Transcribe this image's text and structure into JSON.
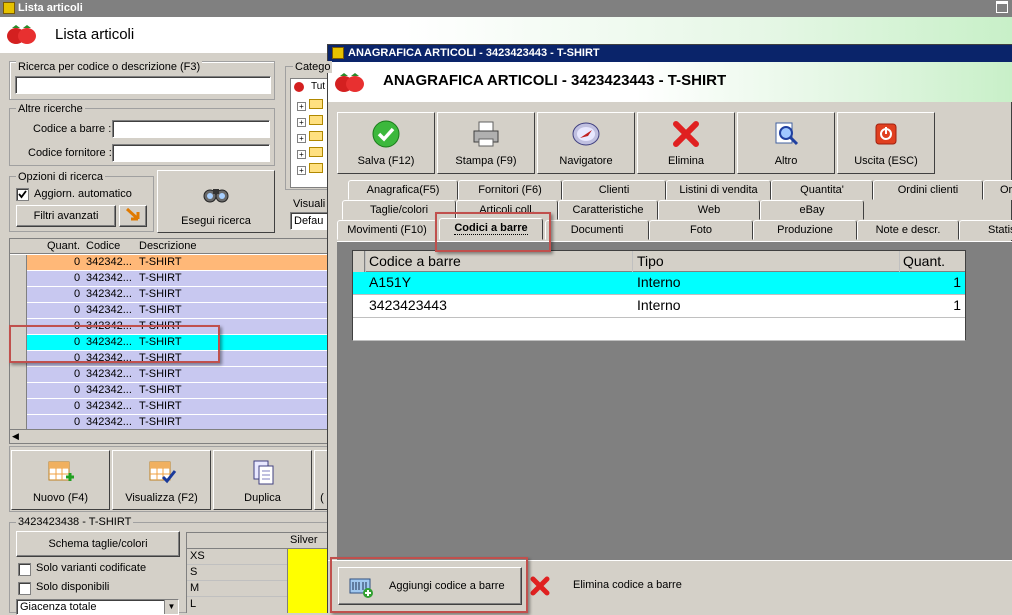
{
  "main_window": {
    "title": "Lista articoli",
    "header_title": "Lista articoli"
  },
  "search": {
    "by_code_label": "Ricerca per codice o descrizione (F3)",
    "by_code_value": "",
    "other_searches_label": "Altre ricerche",
    "barcode_label": "Codice a barre :",
    "supplier_code_label": "Codice fornitore :",
    "options_label": "Opzioni di ricerca",
    "auto_update_label": "Aggiorn. automatico",
    "auto_update_checked": true,
    "advanced_filters_label": "Filtri avanzati",
    "execute_label": "Esegui ricerca",
    "categories_label": "Catego",
    "categories_root": "Tut",
    "view_label": "Visuali",
    "view_value": "Defau"
  },
  "article_grid": {
    "headers": [
      "Quant.",
      "Codice",
      "Descrizione"
    ],
    "rows": [
      {
        "qty": "0",
        "code": "342342...",
        "desc": "T-SHIRT",
        "color": "#ffb878"
      },
      {
        "qty": "0",
        "code": "342342...",
        "desc": "T-SHIRT",
        "color": "#c8c8f0"
      },
      {
        "qty": "0",
        "code": "342342...",
        "desc": "T-SHIRT",
        "color": "#c8c8f0"
      },
      {
        "qty": "0",
        "code": "342342...",
        "desc": "T-SHIRT",
        "color": "#c8c8f0"
      },
      {
        "qty": "0",
        "code": "342342...",
        "desc": "T-SHIRT",
        "color": "#c8c8f0"
      },
      {
        "qty": "0",
        "code": "342342...",
        "desc": "T-SHIRT",
        "color": "#00ffff"
      },
      {
        "qty": "0",
        "code": "342342...",
        "desc": "T-SHIRT",
        "color": "#c8c8f0"
      },
      {
        "qty": "0",
        "code": "342342...",
        "desc": "T-SHIRT",
        "color": "#c8c8f0"
      },
      {
        "qty": "0",
        "code": "342342...",
        "desc": "T-SHIRT",
        "color": "#c8c8f0"
      },
      {
        "qty": "0",
        "code": "342342...",
        "desc": "T-SHIRT",
        "color": "#c8c8f0"
      },
      {
        "qty": "0",
        "code": "342342...",
        "desc": "T-SHIRT",
        "color": "#c8c8f0"
      }
    ]
  },
  "left_actions": {
    "new_label": "Nuovo (F4)",
    "view_label": "Visualizza (F2)",
    "duplicate_label": "Duplica",
    "more_label": "("
  },
  "variants": {
    "group_label": "3423423438 - T-SHIRT",
    "scheme_button": "Schema taglie/colori",
    "only_coded_label": "Solo varianti codificate",
    "only_available_label": "Solo disponibili",
    "stock_select_value": "Giacenza totale",
    "color_header": "Silver",
    "sizes": [
      "XS",
      "S",
      "M",
      "L"
    ]
  },
  "dialog": {
    "title": "ANAGRAFICA ARTICOLI - 3423423443 - T-SHIRT",
    "header_title": "ANAGRAFICA ARTICOLI - 3423423443 - T-SHIRT",
    "toolbar": {
      "save": "Salva (F12)",
      "print": "Stampa (F9)",
      "navigator": "Navigatore",
      "delete": "Elimina",
      "other": "Altro",
      "exit": "Uscita (ESC)"
    },
    "tabs_row1": [
      "Anagrafica(F5)",
      "Fornitori (F6)",
      "Clienti",
      "Listini di vendita",
      "Quantita'",
      "Ordini clienti",
      "Or"
    ],
    "tabs_row2": [
      "Taglie/colori",
      "Articoli coll.",
      "Caratteristiche",
      "Web",
      "eBay"
    ],
    "tabs_row3": [
      "Movimenti (F10)",
      "Codici a barre",
      "Documenti",
      "Foto",
      "Produzione",
      "Note e descr.",
      "Statis"
    ],
    "barcode_grid": {
      "headers": [
        "Codice a barre",
        "Tipo",
        "Quant."
      ],
      "rows": [
        {
          "code": "A151Y",
          "type": "Interno",
          "qty": "1"
        },
        {
          "code": "3423423443",
          "type": "Interno",
          "qty": "1"
        }
      ]
    },
    "add_barcode_label": "Aggiungi codice a barre",
    "delete_barcode_label": "Elimina codice a barre"
  }
}
